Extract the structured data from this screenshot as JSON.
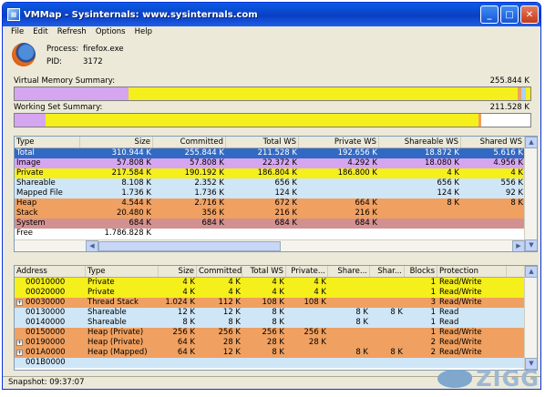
{
  "window": {
    "title": "VMMap - Sysinternals: www.sysinternals.com"
  },
  "menu": [
    "File",
    "Edit",
    "Refresh",
    "Options",
    "Help"
  ],
  "process": {
    "process_label": "Process:",
    "process_value": "firefox.exe",
    "pid_label": "PID:",
    "pid_value": "3172"
  },
  "virtual_summary": {
    "label": "Virtual Memory Summary:",
    "value": "255.844 K"
  },
  "working_summary": {
    "label": "Working Set Summary:",
    "value": "211.528 K"
  },
  "virtual_bar": [
    {
      "color": "#d6a5f0",
      "fraction": 0.22
    },
    {
      "color": "#f5ef1c",
      "fraction": 0.755
    },
    {
      "color": "#f0a060",
      "fraction": 0.008
    },
    {
      "color": "#aad0ff",
      "fraction": 0.008
    },
    {
      "color": "#f5ef1c",
      "fraction": 0.009
    }
  ],
  "working_bar": [
    {
      "color": "#d6a5f0",
      "fraction": 0.06
    },
    {
      "color": "#f5ef1c",
      "fraction": 0.84
    },
    {
      "color": "#f0a060",
      "fraction": 0.005
    },
    {
      "color": "#ffffff",
      "fraction": 0.095
    }
  ],
  "summary_table": {
    "headers": [
      "Type",
      "Size",
      "Committed",
      "Total WS",
      "Private WS",
      "Shareable WS",
      "Shared WS"
    ],
    "rows": [
      {
        "color": "#316ac5",
        "text_color": "#ffffff",
        "cells": [
          "Total",
          "310.944 K",
          "255.844 K",
          "211.528 K",
          "192.656 K",
          "18.872 K",
          "5.616 K"
        ]
      },
      {
        "color": "#d6a5f0",
        "cells": [
          "Image",
          "57.808 K",
          "57.808 K",
          "22.372 K",
          "4.292 K",
          "18.080 K",
          "4.956 K"
        ]
      },
      {
        "color": "#f5ef1c",
        "cells": [
          "Private",
          "217.584 K",
          "190.192 K",
          "186.804 K",
          "186.800 K",
          "4 K",
          "4 K"
        ]
      },
      {
        "color": "#cfe6f7",
        "cells": [
          "Shareable",
          "8.108 K",
          "2.352 K",
          "656 K",
          "",
          "656 K",
          "556 K"
        ]
      },
      {
        "color": "#cfe6f7",
        "cells": [
          "Mapped File",
          "1.736 K",
          "1.736 K",
          "124 K",
          "",
          "124 K",
          "92 K"
        ]
      },
      {
        "color": "#f0a060",
        "cells": [
          "Heap",
          "4.544 K",
          "2.716 K",
          "672 K",
          "664 K",
          "8 K",
          "8 K"
        ]
      },
      {
        "color": "#f0a060",
        "cells": [
          "Stack",
          "20.480 K",
          "356 K",
          "216 K",
          "216 K",
          "",
          ""
        ]
      },
      {
        "color": "#d29090",
        "cells": [
          "System",
          "684 K",
          "684 K",
          "684 K",
          "684 K",
          "",
          ""
        ]
      },
      {
        "color": "#ffffff",
        "cells": [
          "Free",
          "1.786.828 K",
          "",
          "",
          "",
          "",
          ""
        ]
      }
    ]
  },
  "detail_table": {
    "headers": [
      "Address",
      "Type",
      "Size",
      "Committed",
      "Total WS",
      "Private...",
      "Share...",
      "Shar...",
      "Blocks",
      "Protection"
    ],
    "rows": [
      {
        "color": "#f5ef1c",
        "expand": "",
        "cells": [
          "00010000",
          "Private",
          "4 K",
          "4 K",
          "4 K",
          "4 K",
          "",
          "",
          "1",
          "Read/Write"
        ]
      },
      {
        "color": "#f5ef1c",
        "expand": "",
        "cells": [
          "00020000",
          "Private",
          "4 K",
          "4 K",
          "4 K",
          "4 K",
          "",
          "",
          "1",
          "Read/Write"
        ]
      },
      {
        "color": "#f0a060",
        "expand": "+",
        "cells": [
          "00030000",
          "Thread Stack",
          "1.024 K",
          "112 K",
          "108 K",
          "108 K",
          "",
          "",
          "3",
          "Read/Write"
        ]
      },
      {
        "color": "#cfe6f7",
        "expand": "",
        "cells": [
          "00130000",
          "Shareable",
          "12 K",
          "12 K",
          "8 K",
          "",
          "8 K",
          "8 K",
          "1",
          "Read"
        ]
      },
      {
        "color": "#cfe6f7",
        "expand": "",
        "cells": [
          "00140000",
          "Shareable",
          "8 K",
          "8 K",
          "8 K",
          "",
          "8 K",
          "",
          "1",
          "Read"
        ]
      },
      {
        "color": "#f0a060",
        "expand": "",
        "cells": [
          "00150000",
          "Heap (Private)",
          "256 K",
          "256 K",
          "256 K",
          "256 K",
          "",
          "",
          "1",
          "Read/Write"
        ]
      },
      {
        "color": "#f0a060",
        "expand": "+",
        "cells": [
          "00190000",
          "Heap (Private)",
          "64 K",
          "28 K",
          "28 K",
          "28 K",
          "",
          "",
          "2",
          "Read/Write"
        ]
      },
      {
        "color": "#f0a060",
        "expand": "+",
        "cells": [
          "001A0000",
          "Heap (Mapped)",
          "64 K",
          "12 K",
          "8 K",
          "",
          "8 K",
          "8 K",
          "2",
          "Read/Write"
        ]
      },
      {
        "color": "#cfe6f7",
        "expand": "",
        "cells": [
          "001B0000",
          "",
          "",
          "",
          "",
          "",
          "",
          "",
          "",
          ""
        ]
      }
    ]
  },
  "status": {
    "text": "Snapshot: 09:37:07"
  },
  "watermark": {
    "text": "ZIGG"
  }
}
